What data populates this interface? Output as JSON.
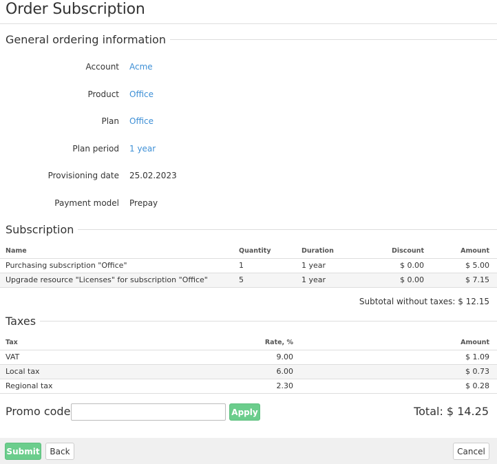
{
  "page": {
    "title": "Order Subscription"
  },
  "general": {
    "heading": "General ordering information",
    "fields": [
      {
        "label": "Account",
        "value": "Acme"
      },
      {
        "label": "Product",
        "value": "Office"
      },
      {
        "label": "Plan",
        "value": "Office"
      },
      {
        "label": "Plan period",
        "value": "1 year"
      },
      {
        "label": "Provisioning date",
        "value": "25.02.2023"
      },
      {
        "label": "Payment model",
        "value": "Prepay"
      }
    ]
  },
  "subscription": {
    "heading": "Subscription",
    "columns": [
      "Name",
      "Quantity",
      "Duration",
      "Discount",
      "Amount"
    ],
    "rows": [
      {
        "name": "Purchasing subscription \"Office\"",
        "quantity": "1",
        "duration": "1 year",
        "discount": "$ 0.00",
        "amount": "$ 5.00"
      },
      {
        "name": "Upgrade resource \"Licenses\" for subscription \"Office\"",
        "quantity": "5",
        "duration": "1 year",
        "discount": "$ 0.00",
        "amount": "$ 7.15"
      }
    ],
    "subtotal": "Subtotal without taxes: $ 12.15"
  },
  "taxes": {
    "heading": "Taxes",
    "columns": [
      "Tax",
      "Rate, %",
      "Amount"
    ],
    "rows": [
      {
        "tax": "VAT",
        "rate": "9.00",
        "amount": "$ 1.09"
      },
      {
        "tax": "Local tax",
        "rate": "6.00",
        "amount": "$ 0.73"
      },
      {
        "tax": "Regional tax",
        "rate": "2.30",
        "amount": "$ 0.28"
      }
    ]
  },
  "promo": {
    "label": "Promo code",
    "value": "",
    "apply_label": "Apply"
  },
  "total": "Total: $ 14.25",
  "footer": {
    "submit_label": "Submit",
    "back_label": "Back",
    "cancel_label": "Cancel"
  },
  "colors": {
    "accent_green": "#6bcd8c",
    "link_blue": "#3d8fd6",
    "footer_bg": "#f0f0f0"
  }
}
